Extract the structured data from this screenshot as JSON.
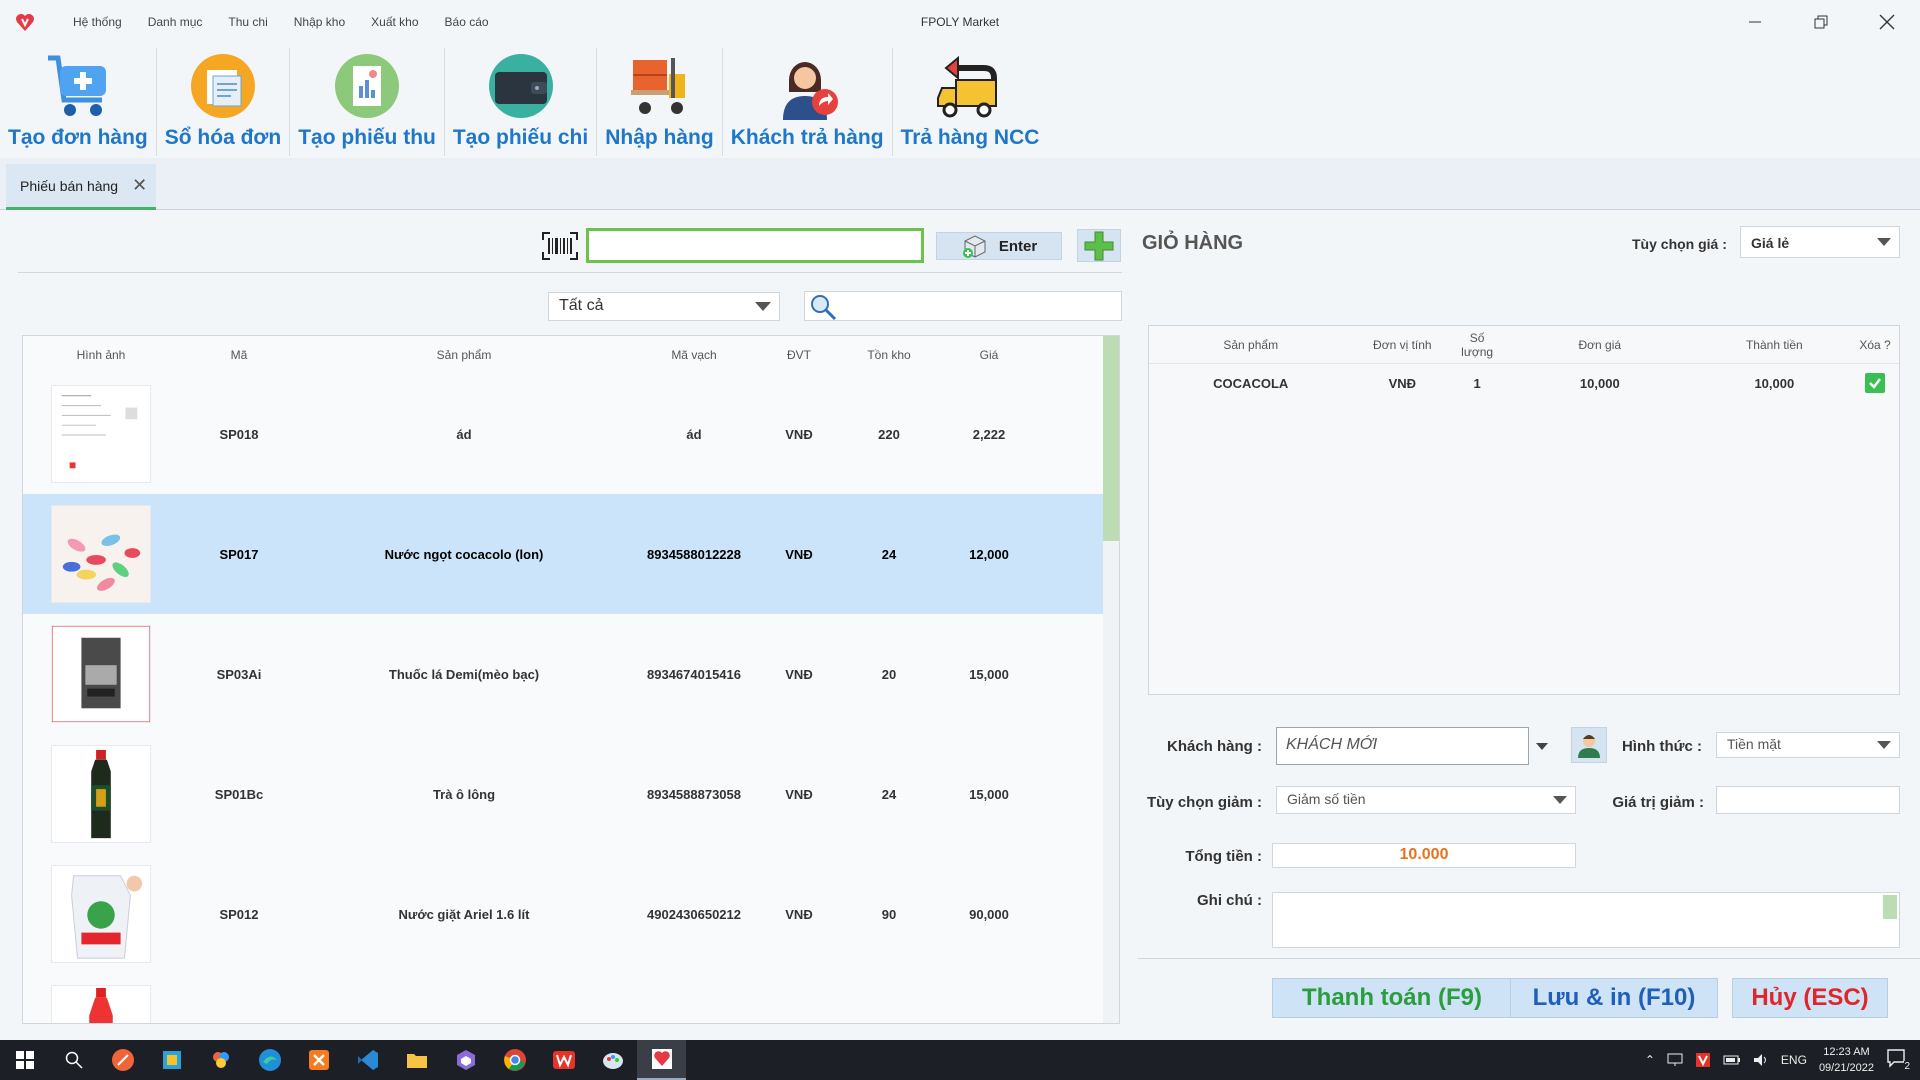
{
  "window": {
    "title": "FPOLY Market"
  },
  "menu": [
    "Hệ thống",
    "Danh mục",
    "Thu chi",
    "Nhập kho",
    "Xuất kho",
    "Báo cáo"
  ],
  "ribbon": [
    {
      "label": "Tạo đơn hàng",
      "icon": "cart-add-icon"
    },
    {
      "label": "Sổ hóa đơn",
      "icon": "invoice-book-icon"
    },
    {
      "label": "Tạo phiếu thu",
      "icon": "receipt-icon"
    },
    {
      "label": "Tạo phiếu chi",
      "icon": "wallet-icon"
    },
    {
      "label": "Nhập hàng",
      "icon": "forklift-icon"
    },
    {
      "label": "Khách trả hàng",
      "icon": "customer-return-icon"
    },
    {
      "label": "Trả hàng NCC",
      "icon": "truck-return-icon"
    }
  ],
  "doc_tab": {
    "label": "Phiếu bán hàng"
  },
  "scan": {
    "value": "",
    "enter_label": "Enter"
  },
  "filter": {
    "category_selected": "Tất cả",
    "search_value": ""
  },
  "products": {
    "headers": [
      "Hình ảnh",
      "Mã",
      "Sản phẩm",
      "Mã vạch",
      "ĐVT",
      "Tồn kho",
      "Giá"
    ],
    "rows": [
      {
        "code": "SP018",
        "name": "ád",
        "barcode": "ád",
        "unit": "VNĐ",
        "stock": "220",
        "price": "2,222"
      },
      {
        "code": "SP017",
        "name": "Nước ngọt cocacolo (lon)",
        "barcode": "8934588012228",
        "unit": "VNĐ",
        "stock": "24",
        "price": "12,000"
      },
      {
        "code": "SP03Ai",
        "name": "Thuốc lá Demi(mèo bạc)",
        "barcode": "8934674015416",
        "unit": "VNĐ",
        "stock": "20",
        "price": "15,000"
      },
      {
        "code": "SP01Bc",
        "name": "Trà ô lông",
        "barcode": "8934588873058",
        "unit": "VNĐ",
        "stock": "24",
        "price": "15,000"
      },
      {
        "code": "SP012",
        "name": "Nước giặt Ariel 1.6 lít",
        "barcode": "4902430650212",
        "unit": "VNĐ",
        "stock": "90",
        "price": "90,000"
      }
    ]
  },
  "cart": {
    "title": "GIỎ HÀNG",
    "price_option_label": "Tùy chọn giá :",
    "price_option_value": "Giá lẻ",
    "headers": [
      "Sản phẩm",
      "Đơn vị tính",
      "Số lượng",
      "Đơn giá",
      "Thành tiền",
      "Xóa ?"
    ],
    "rows": [
      {
        "product": "COCACOLA",
        "unit": "VNĐ",
        "qty": "1",
        "unit_price": "10,000",
        "total": "10,000"
      }
    ]
  },
  "form": {
    "customer_label": "Khách hàng :",
    "customer_value": "KHÁCH MỚI",
    "payment_label": "Hình thức :",
    "payment_value": "Tiền mặt",
    "discount_option_label": "Tùy chọn giảm :",
    "discount_option_value": "Giảm số tiền",
    "discount_value_label": "Giá trị giảm :",
    "discount_value": "",
    "total_label": "Tổng tiền :",
    "total_value": "10.000",
    "note_label": "Ghi chú :",
    "note_value": ""
  },
  "actions": {
    "pay": "Thanh toán (F9)",
    "save_print": "Lưu & in (F10)",
    "cancel": "Hủy (ESC)"
  },
  "taskbar": {
    "lang": "ENG",
    "time": "12:23 AM",
    "date": "09/21/2022",
    "notifications": "2"
  },
  "colors": {
    "accent_blue": "#1e77c8",
    "accent_green": "#6cc24a",
    "pay_green": "#2a9d3c",
    "cancel_red": "#e0262b",
    "total_orange": "#e8731e"
  }
}
